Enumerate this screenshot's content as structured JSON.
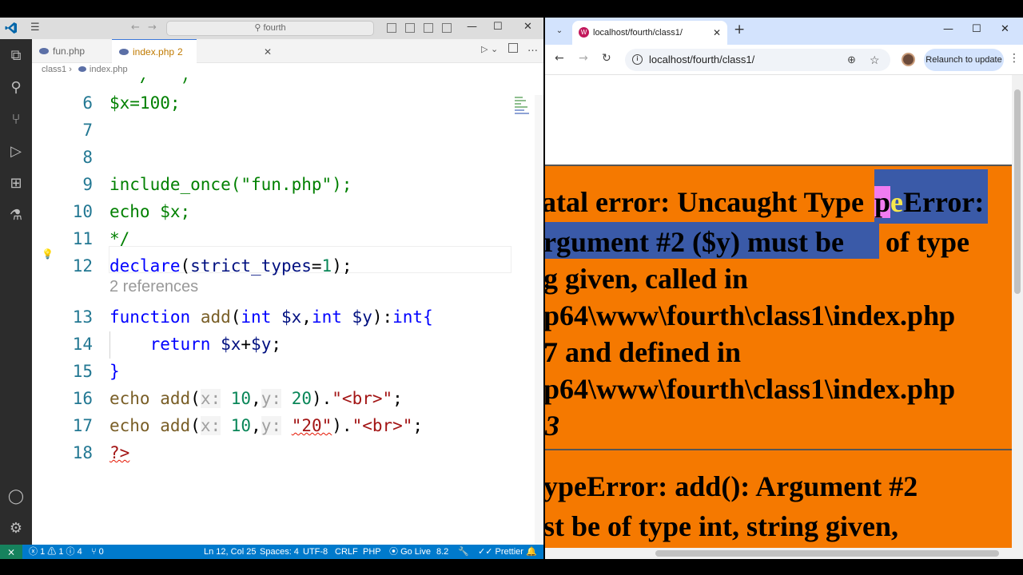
{
  "vscode": {
    "search_text": "fourth",
    "tabs": [
      {
        "label": "fun.php"
      },
      {
        "label": "index.php",
        "modified_count": "2"
      }
    ],
    "breadcrumb": [
      "class1",
      "index.php"
    ],
    "line_numbers": [
      "6",
      "7",
      "8",
      "9",
      "10",
      "11",
      "12",
      "13",
      "14",
      "15",
      "16",
      "17",
      "18"
    ],
    "codelens": "2 references",
    "status": {
      "errors": "1",
      "warnings": "1",
      "info": "4",
      "ports": "0",
      "cursor": "Ln 12, Col 25",
      "spaces": "Spaces: 4",
      "encoding": "UTF-8",
      "eol": "CRLF",
      "language": "PHP",
      "golive": "Go Live",
      "php_version": "8.2",
      "prettier": "Prettier"
    },
    "accent_color": "#007acc"
  },
  "browser": {
    "tab_title": "localhost/fourth/class1/",
    "url": "localhost/fourth/class1/",
    "relaunch_label": "Relaunch to update",
    "error_color": "#f57900",
    "error1_lines": [
      "atal error: Uncaught Type",
      "Error:",
      "rgument #2 ($y) must be",
      "of type",
      "g given, called in",
      "p64\\www\\fourth\\class1\\index.php",
      "7 and defined in",
      "p64\\www\\fourth\\class1\\index.php",
      "3"
    ],
    "error2_lines": [
      "ypeError: add(): Argument #2",
      "st be of type int, string given,"
    ]
  }
}
